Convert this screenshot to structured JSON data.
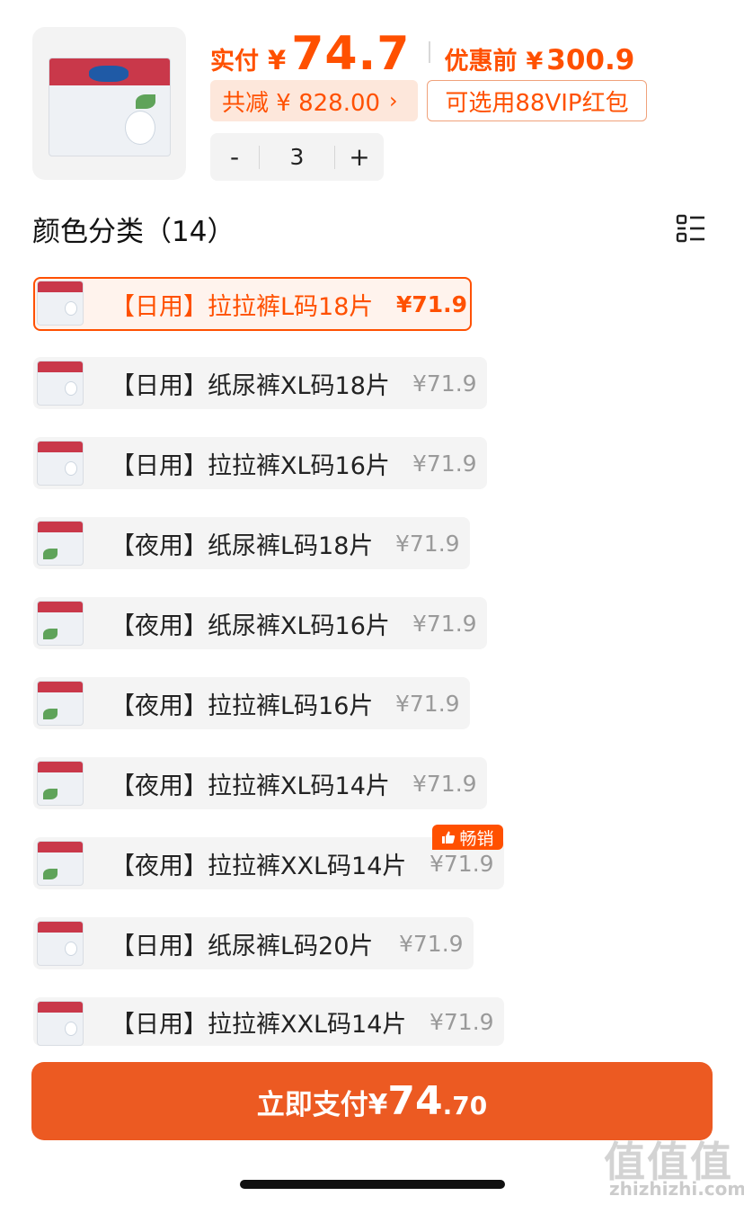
{
  "product": {
    "image_icon": "diaper-package-icon",
    "pay_label": "实付",
    "pay_currency": "¥",
    "pay_amount": "74.7",
    "orig_label": "优惠前",
    "orig_currency": "¥",
    "orig_amount": "300.9",
    "discount_text": "共减 ¥ 828.00",
    "discount_chevron": "›",
    "vip_text": "可选用88VIP红包"
  },
  "quantity": {
    "minus": "-",
    "value": "3",
    "plus": "+"
  },
  "section": {
    "title": "颜色分类（14）",
    "toggle_icon": "list-view-icon"
  },
  "options": [
    {
      "label": "【日用】拉拉裤L码18片",
      "price": "¥71.9",
      "selected": true
    },
    {
      "label": "【日用】纸尿裤XL码18片",
      "price": "¥71.9",
      "selected": false
    },
    {
      "label": "【日用】拉拉裤XL码16片",
      "price": "¥71.9",
      "selected": false
    },
    {
      "label": "【夜用】纸尿裤L码18片",
      "price": "¥71.9",
      "selected": false
    },
    {
      "label": "【夜用】纸尿裤XL码16片",
      "price": "¥71.9",
      "selected": false
    },
    {
      "label": "【夜用】拉拉裤L码16片",
      "price": "¥71.9",
      "selected": false
    },
    {
      "label": "【夜用】拉拉裤XL码14片",
      "price": "¥71.9",
      "selected": false
    },
    {
      "label": "【夜用】拉拉裤XXL码14片",
      "price": "¥71.9",
      "selected": false
    },
    {
      "label": "【日用】纸尿裤L码20片",
      "price": "¥71.9",
      "selected": false
    },
    {
      "label": "【日用】拉拉裤XXL码14片",
      "price": "¥71.9",
      "selected": false
    }
  ],
  "hot_badge": {
    "text": "畅销",
    "icon": "thumbs-up-icon"
  },
  "pay_button": {
    "label": "立即支付¥",
    "amount_int": "74",
    "amount_dec": ".70"
  },
  "watermark": {
    "glyphs": "值值值",
    "text": "zhizhizhi.com"
  },
  "colors": {
    "accent": "#ff5000",
    "button": "#ec5a22",
    "tag_bg": "#fde7db"
  }
}
